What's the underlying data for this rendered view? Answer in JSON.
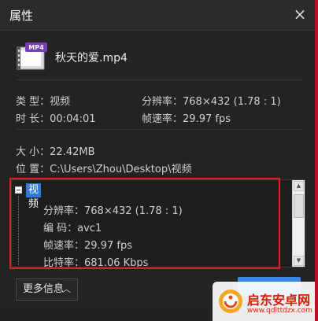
{
  "window": {
    "title": "属性",
    "close_glyph": "×"
  },
  "file": {
    "name": "秋天的爱.mp4",
    "icon": "mp4-file-icon",
    "badge": "MP4"
  },
  "summary": {
    "type_label": "类  型：",
    "type_value": "视频",
    "resolution_label": "分辨率：",
    "resolution_value": "768×432 (1.78 : 1)",
    "duration_label": "时  长：",
    "duration_value": "00:04:01",
    "framerate_label": "帧速率：",
    "framerate_value": "29.97 fps",
    "size_label": "大  小：",
    "size_value": "22.42MB",
    "location_label": "位  置：",
    "location_value": "C:\\Users\\Zhou\\Desktop\\视频"
  },
  "tree": {
    "node_label": "视频",
    "details": [
      {
        "label": "分辨率：",
        "value": "768×432 (1.78 : 1)"
      },
      {
        "label": "编    码：",
        "value": "avc1"
      },
      {
        "label": "帧速率：",
        "value": "29.97 fps"
      },
      {
        "label": "比特率：",
        "value": "681.06 Kbps"
      }
    ]
  },
  "buttons": {
    "more_label": "更多信息",
    "more_chevron": "︿"
  },
  "watermark": {
    "line1": "启东安卓网",
    "line2": "www.qdlttdzx.com"
  },
  "colors": {
    "accent": "#2f7ad9",
    "highlight": "#e01e1e",
    "watermark": "#d81e06"
  }
}
